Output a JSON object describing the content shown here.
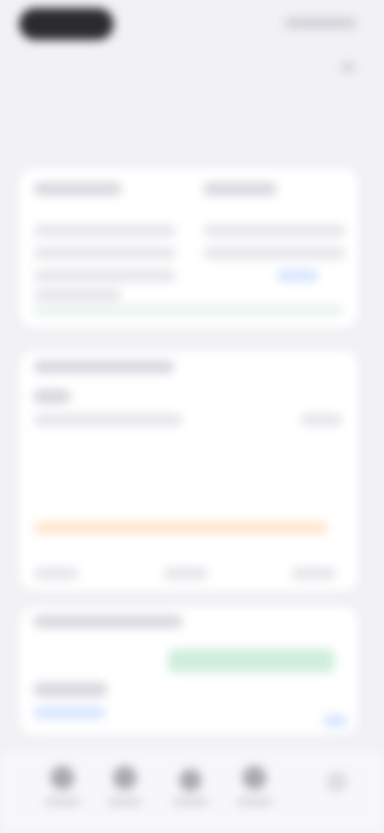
{
  "statusbar": {
    "time": "",
    "indicators": ""
  },
  "header": {
    "title": "",
    "subtitle": ""
  },
  "cards": [
    {
      "left_heading": "",
      "right_heading": "",
      "footer": ""
    },
    {
      "heading": "",
      "value": "",
      "line": "",
      "pill": ""
    },
    {
      "heading": "",
      "value": "",
      "link": ""
    }
  ],
  "bottom_nav": {
    "items": [
      "",
      "",
      "",
      ""
    ],
    "fab_icon": "plus-icon"
  }
}
